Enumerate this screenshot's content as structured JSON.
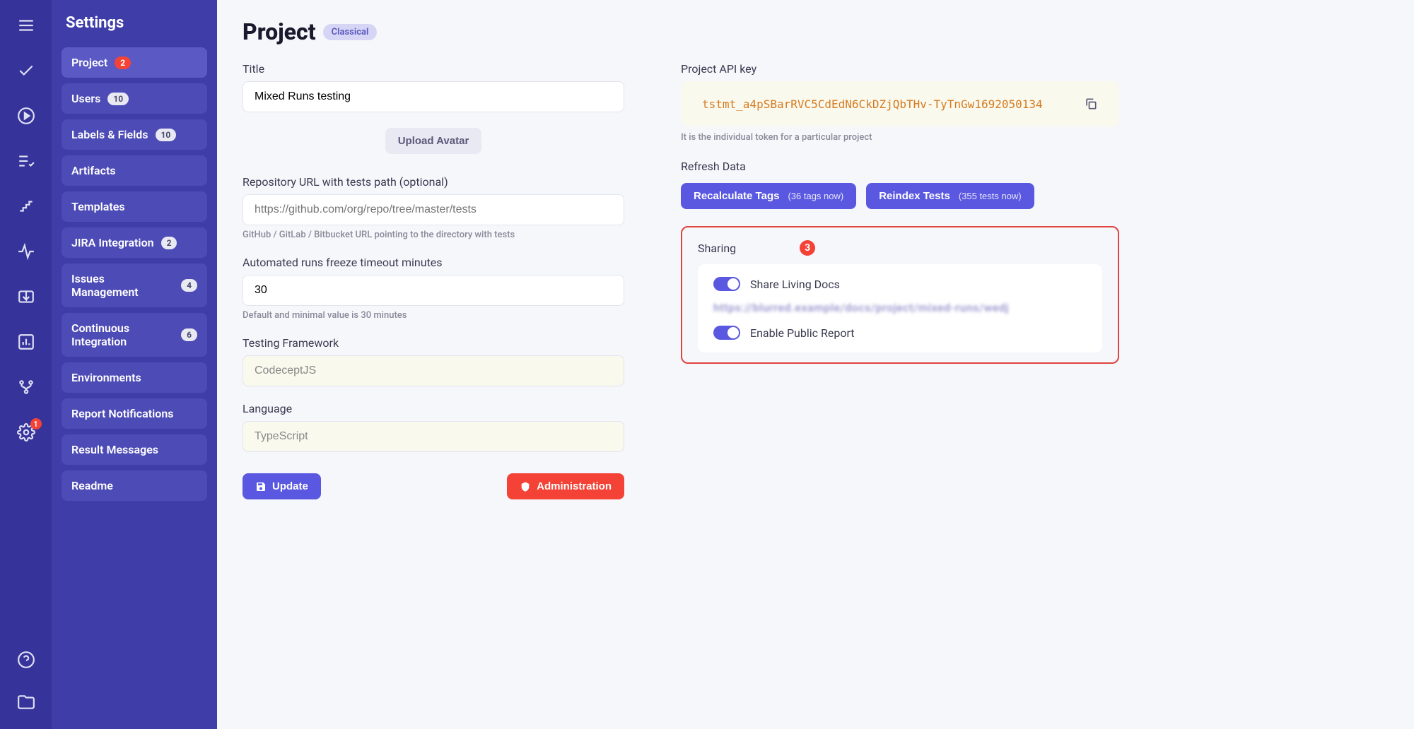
{
  "sidebar": {
    "title": "Settings",
    "items": [
      {
        "label": "Project",
        "badge": "2",
        "badgeClass": "red",
        "active": true
      },
      {
        "label": "Users",
        "badge": "10"
      },
      {
        "label": "Labels & Fields",
        "badge": "10"
      },
      {
        "label": "Artifacts"
      },
      {
        "label": "Templates"
      },
      {
        "label": "JIRA Integration",
        "badge": "2"
      },
      {
        "label": "Issues Management",
        "badge": "4"
      },
      {
        "label": "Continuous Integration",
        "badge": "6"
      },
      {
        "label": "Environments"
      },
      {
        "label": "Report Notifications"
      },
      {
        "label": "Result Messages"
      },
      {
        "label": "Readme"
      }
    ]
  },
  "rail": {
    "settings_badge": "1"
  },
  "header": {
    "title": "Project",
    "tag": "Classical"
  },
  "form": {
    "title_label": "Title",
    "title_value": "Mixed Runs testing",
    "upload_avatar": "Upload Avatar",
    "repo_label": "Repository URL with tests path (optional)",
    "repo_placeholder": "https://github.com/org/repo/tree/master/tests",
    "repo_help": "GitHub / GitLab / Bitbucket URL pointing to the directory with tests",
    "freeze_label": "Automated runs freeze timeout minutes",
    "freeze_value": "30",
    "freeze_help": "Default and minimal value is 30 minutes",
    "framework_label": "Testing Framework",
    "framework_value": "CodeceptJS",
    "language_label": "Language",
    "language_value": "TypeScript",
    "update_btn": "Update",
    "admin_btn": "Administration"
  },
  "api": {
    "label": "Project API key",
    "key": "tstmt_a4pSBarRVC5CdEdN6CkDZjQbTHv-TyTnGw1692050134",
    "help": "It is the individual token for a particular project"
  },
  "refresh": {
    "label": "Refresh Data",
    "recalc": "Recalculate Tags",
    "recalc_sub": "(36 tags now)",
    "reindex": "Reindex Tests",
    "reindex_sub": "(355 tests now)"
  },
  "sharing": {
    "label": "Sharing",
    "badge": "3",
    "living_docs": "Share Living Docs",
    "blurred": "https://blurred.example/docs/project/mixed-runs/wedj",
    "public_report": "Enable Public Report"
  }
}
